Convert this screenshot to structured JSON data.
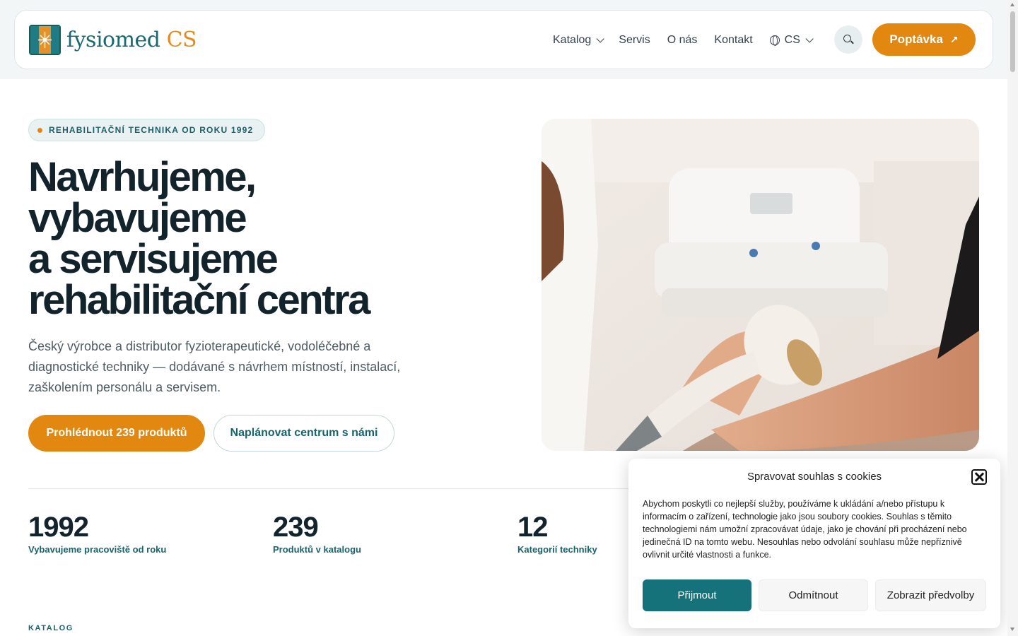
{
  "header": {
    "logo_text": "fysiomed",
    "logo_suffix": "CS",
    "nav": [
      {
        "label": "Katalog"
      },
      {
        "label": "Servis"
      },
      {
        "label": "O nás"
      },
      {
        "label": "Kontakt"
      }
    ],
    "language": "CS",
    "cta_label": "Poptávka",
    "cta_arrow": "↗"
  },
  "hero": {
    "badge": "REHABILITAČNÍ TECHNIKA OD ROKU 1992",
    "title_lines": [
      "Navrhujeme,",
      "vybavujeme",
      "a servisujeme",
      "rehabilitační centra"
    ],
    "subtitle": "Český výrobce a distributor fyzioterapeutické, vodoléčebné a diagnostické techniky — dodávané s návrhem místností, instalací, zaškolením personálu a servisem.",
    "primary_button": "Prohlédnout 239 produktů",
    "secondary_button": "Naplánovat centrum s námi"
  },
  "stats": [
    {
      "value": "1992",
      "label": "Vybavujeme pracoviště od roku"
    },
    {
      "value": "239",
      "label": "Produktů v katalogu"
    },
    {
      "value": "12",
      "label": "Kategorií techniky"
    }
  ],
  "section_label": "KATALOG",
  "cookie": {
    "title": "Spravovat souhlas s cookies",
    "text": "Abychom poskytli co nejlepší služby, používáme k ukládání a/nebo přístupu k informacím o zařízení, technologie jako jsou soubory cookies. Souhlas s těmito technologiemi nám umožní zpracovávat údaje, jako je chování při procházení nebo jedinečná ID na tomto webu. Nesouhlas nebo odvolání souhlasu může nepříznivě ovlivnit určité vlastnosti a funkce.",
    "accept": "Přijmout",
    "deny": "Odmítnout",
    "preferences": "Zobrazit předvolby"
  },
  "colors": {
    "accent": "#e2870f",
    "brand": "#17646c",
    "text": "#12232b"
  }
}
